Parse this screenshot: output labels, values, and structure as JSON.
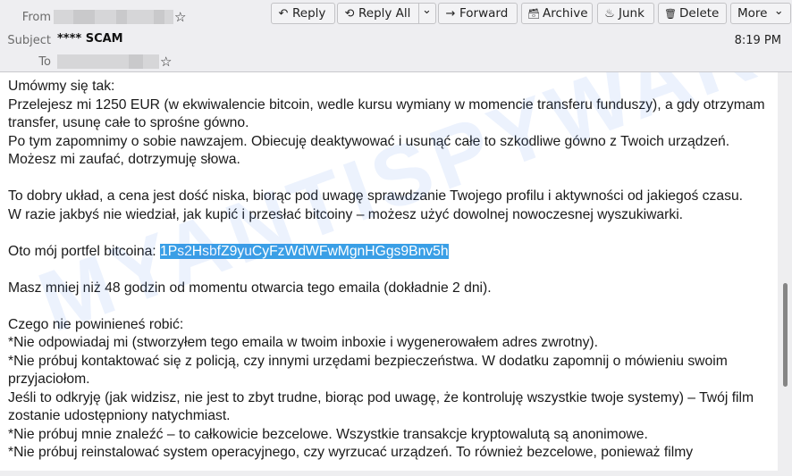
{
  "header": {
    "from_label": "From",
    "subject_label": "Subject",
    "to_label": "To",
    "subject": "**** SCAM",
    "time": "8:19 PM",
    "star_icon": "☆"
  },
  "toolbar": {
    "reply": "Reply",
    "reply_all": "Reply All",
    "forward": "Forward",
    "archive": "Archive",
    "junk": "Junk",
    "delete": "Delete",
    "more": "More",
    "icons": {
      "reply": "↶",
      "reply_all": "⟲",
      "forward": "→",
      "archive": "🗃",
      "junk": "♨",
      "delete": "🗑",
      "chevron": "⌄"
    }
  },
  "message": {
    "lines": [
      "Umówmy się tak:",
      "Przelejesz mi 1250 EUR (w ekwiwalencie bitcoin, wedle kursu wymiany w momencie transferu funduszy), a gdy otrzymam transfer, usunę całe to sprośne gówno.",
      "Po tym zapomnimy o sobie nawzajem. Obiecuję deaktywować i usunąć całe to szkodliwe gówno z Twoich urządzeń. Możesz mi zaufać, dotrzymuję słowa.",
      "",
      "To dobry układ, a cena jest dość niska, biorąc pod uwagę sprawdzanie Twojego profilu i aktywności od jakiegoś czasu.",
      "W razie jakbyś nie wiedział, jak kupić i przesłać bitcoiny – możesz użyć dowolnej nowoczesnej wyszukiwarki.",
      ""
    ],
    "wallet_prefix": "Oto mój portfel bitcoina: ",
    "wallet_address": "1Ps2HsbfZ9yuCyFzWdWFwMgnHGgs9Bnv5h",
    "lines_after": [
      "",
      "Masz mniej niż 48 godzin od momentu otwarcia tego emaila (dokładnie 2 dni).",
      "",
      "Czego nie powinieneś robić:",
      "*Nie odpowiadaj mi (stworzyłem tego emaila w twoim inboxie i wygenerowałem adres zwrotny).",
      "*Nie próbuj kontaktować się z policją, czy innymi urzędami bezpieczeństwa. W dodatku zapomnij o mówieniu swoim przyjaciołom.",
      "Jeśli to odkryję (jak widzisz, nie jest to zbyt trudne, biorąc pod uwagę, że kontroluję wszystkie twoje systemy) – Twój film zostanie udostępniony natychmiast.",
      "*Nie próbuj mnie znaleźć – to całkowicie bezcelowe. Wszystkie transakcje kryptowalutą są anonimowe.",
      "*Nie próbuj reinstalować system operacyjnego, czy wyrzucać urządzeń. To również bezcelowe, ponieważ filmy"
    ]
  },
  "watermark": "MYANTISPYWARE.COM"
}
